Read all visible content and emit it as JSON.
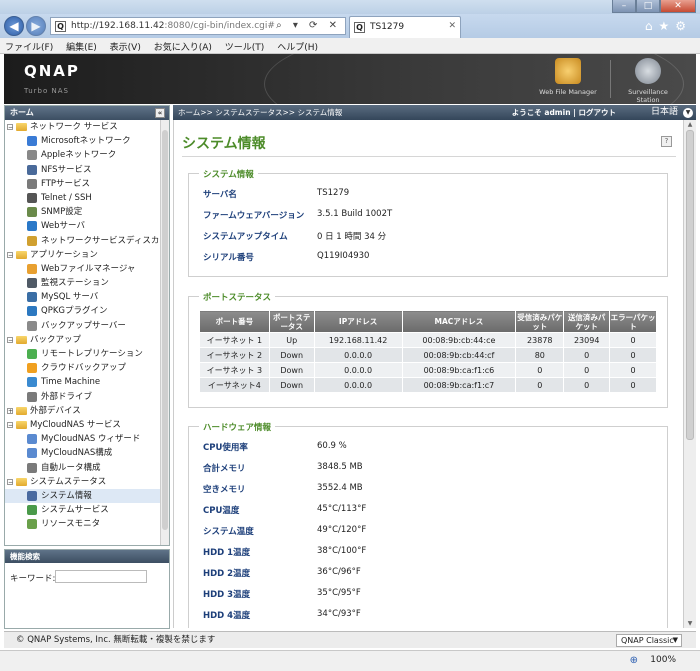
{
  "browser": {
    "url_main": "http://192.168.11.42",
    "url_rest": ":8080/cgi-bin/index.cgi#",
    "addr_controls": "⌕ ▾ ⟳ ✕",
    "tab_title": "TS1279",
    "win_controls": [
      "–",
      "□",
      "✕"
    ],
    "right_icons": [
      "home-icon",
      "star-icon",
      "gear-icon"
    ],
    "menu": [
      "ファイル(F)",
      "編集(E)",
      "表示(V)",
      "お気に入り(A)",
      "ツール(T)",
      "ヘルプ(H)"
    ],
    "zoom": "100%"
  },
  "header": {
    "logo": "QNAP",
    "subtitle": "Turbo NAS",
    "apps": [
      {
        "label": "Web File Manager",
        "icon": "web-file-manager-icon",
        "color": "#e0a030"
      },
      {
        "label": "Surveillance Station",
        "icon": "camera-icon",
        "color": "#9aa2ac"
      }
    ]
  },
  "sidebar": {
    "title": "ホーム",
    "collapse": "«",
    "items": [
      {
        "label": "ネットワーク サービス",
        "level": 0,
        "type": "folder",
        "expanded": true
      },
      {
        "label": "Microsoftネットワーク",
        "level": 1,
        "type": "item",
        "color": "#3a7bd5"
      },
      {
        "label": "Appleネットワーク",
        "level": 1,
        "type": "item",
        "color": "#888888"
      },
      {
        "label": "NFSサービス",
        "level": 1,
        "type": "item",
        "color": "#4a6a9a"
      },
      {
        "label": "FTPサービス",
        "level": 1,
        "type": "item",
        "color": "#7a7a7a"
      },
      {
        "label": "Telnet / SSH",
        "level": 1,
        "type": "item",
        "color": "#555555"
      },
      {
        "label": "SNMP設定",
        "level": 1,
        "type": "item",
        "color": "#6a8a4a"
      },
      {
        "label": "Webサーバ",
        "level": 1,
        "type": "item",
        "color": "#2a78c8"
      },
      {
        "label": "ネットワークサービスディスカバリ",
        "level": 1,
        "type": "item",
        "color": "#d0a030"
      },
      {
        "label": "アプリケーション",
        "level": 0,
        "type": "folder",
        "expanded": true
      },
      {
        "label": "Webファイルマネージャ",
        "level": 1,
        "type": "item",
        "color": "#e8a030"
      },
      {
        "label": "監視ステーション",
        "level": 1,
        "type": "item",
        "color": "#505a66"
      },
      {
        "label": "MySQL サーバ",
        "level": 1,
        "type": "item",
        "color": "#3a6ea5"
      },
      {
        "label": "QPKGプラグイン",
        "level": 1,
        "type": "item",
        "color": "#2c78c0"
      },
      {
        "label": "バックアップサーバー",
        "level": 1,
        "type": "item",
        "color": "#8a8a8a"
      },
      {
        "label": "バックアップ",
        "level": 0,
        "type": "folder",
        "expanded": true
      },
      {
        "label": "リモートレプリケーション",
        "level": 1,
        "type": "item",
        "color": "#4caf50"
      },
      {
        "label": "クラウドバックアップ",
        "level": 1,
        "type": "item",
        "color": "#f0a020"
      },
      {
        "label": "Time Machine",
        "level": 1,
        "type": "item",
        "color": "#3a8ad0"
      },
      {
        "label": "外部ドライブ",
        "level": 1,
        "type": "item",
        "color": "#7a7a7a"
      },
      {
        "label": "外部デバイス",
        "level": 0,
        "type": "folder",
        "expanded": false
      },
      {
        "label": "MyCloudNAS サービス",
        "level": 0,
        "type": "folder",
        "expanded": true
      },
      {
        "label": "MyCloudNAS ウィザード",
        "level": 1,
        "type": "item",
        "color": "#5a8ad0"
      },
      {
        "label": "MyCloudNAS構成",
        "level": 1,
        "type": "item",
        "color": "#5a8ad0"
      },
      {
        "label": "自動ルータ構成",
        "level": 1,
        "type": "item",
        "color": "#7a7a7a"
      },
      {
        "label": "システムステータス",
        "level": 0,
        "type": "folder",
        "expanded": true
      },
      {
        "label": "システム情報",
        "level": 1,
        "type": "item",
        "color": "#4a6aa0",
        "selected": true
      },
      {
        "label": "システムサービス",
        "level": 1,
        "type": "item",
        "color": "#4a9a4a"
      },
      {
        "label": "リソースモニタ",
        "level": 1,
        "type": "item",
        "color": "#6aa04a"
      }
    ]
  },
  "search": {
    "title": "機能検索",
    "keyword_label": "キーワード:"
  },
  "crumb": {
    "path": "ホーム>> システムステータス>> システム情報",
    "welcome": "ようこそ admin | ログアウト",
    "language": "日本語"
  },
  "page": {
    "title": "システム情報",
    "help": "?"
  },
  "system_info": {
    "legend": "システム情報",
    "rows": [
      {
        "k": "サーバ名",
        "v": "TS1279"
      },
      {
        "k": "ファームウェアバージョン",
        "v": "3.5.1 Build 1002T"
      },
      {
        "k": "システムアップタイム",
        "v": "0 日 1 時間 34 分"
      },
      {
        "k": "シリアル番号",
        "v": "Q119I04930"
      }
    ]
  },
  "port_status": {
    "legend": "ポートステータス",
    "headers": [
      "ポート番号",
      "ポートステータス",
      "IPアドレス",
      "MACアドレス",
      "受信済みパケット",
      "送信済みパケット",
      "エラーパケット"
    ],
    "rows": [
      [
        "イーサネット 1",
        "Up",
        "192.168.11.42",
        "00:08:9b:cb:44:ce",
        "23878",
        "23094",
        "0"
      ],
      [
        "イーサネット 2",
        "Down",
        "0.0.0.0",
        "00:08:9b:cb:44:cf",
        "80",
        "0",
        "0"
      ],
      [
        "イーサネット 3",
        "Down",
        "0.0.0.0",
        "00:08:9b:ca:f1:c6",
        "0",
        "0",
        "0"
      ],
      [
        "イーサネット4",
        "Down",
        "0.0.0.0",
        "00:08:9b:ca:f1:c7",
        "0",
        "0",
        "0"
      ]
    ]
  },
  "hardware": {
    "legend": "ハードウェア情報",
    "rows": [
      {
        "k": "CPU使用率",
        "v": "60.9 %"
      },
      {
        "k": "合計メモリ",
        "v": "3848.5 MB"
      },
      {
        "k": "空きメモリ",
        "v": "3552.4 MB"
      },
      {
        "k": "CPU温度",
        "v": "45°C/113°F"
      },
      {
        "k": "システム温度",
        "v": "49°C/120°F"
      },
      {
        "k": "HDD 1温度",
        "v": "38°C/100°F"
      },
      {
        "k": "HDD 2温度",
        "v": "36°C/96°F"
      },
      {
        "k": "HDD 3温度",
        "v": "35°C/95°F"
      },
      {
        "k": "HDD 4温度",
        "v": "34°C/93°F"
      }
    ]
  },
  "footer": {
    "copyright": "© QNAP Systems, Inc. 無断転載・複製を禁じます",
    "theme": "QNAP Classic"
  },
  "colors": {
    "accent_green": "#4d8c2a",
    "label_blue": "#1d3f7a"
  }
}
